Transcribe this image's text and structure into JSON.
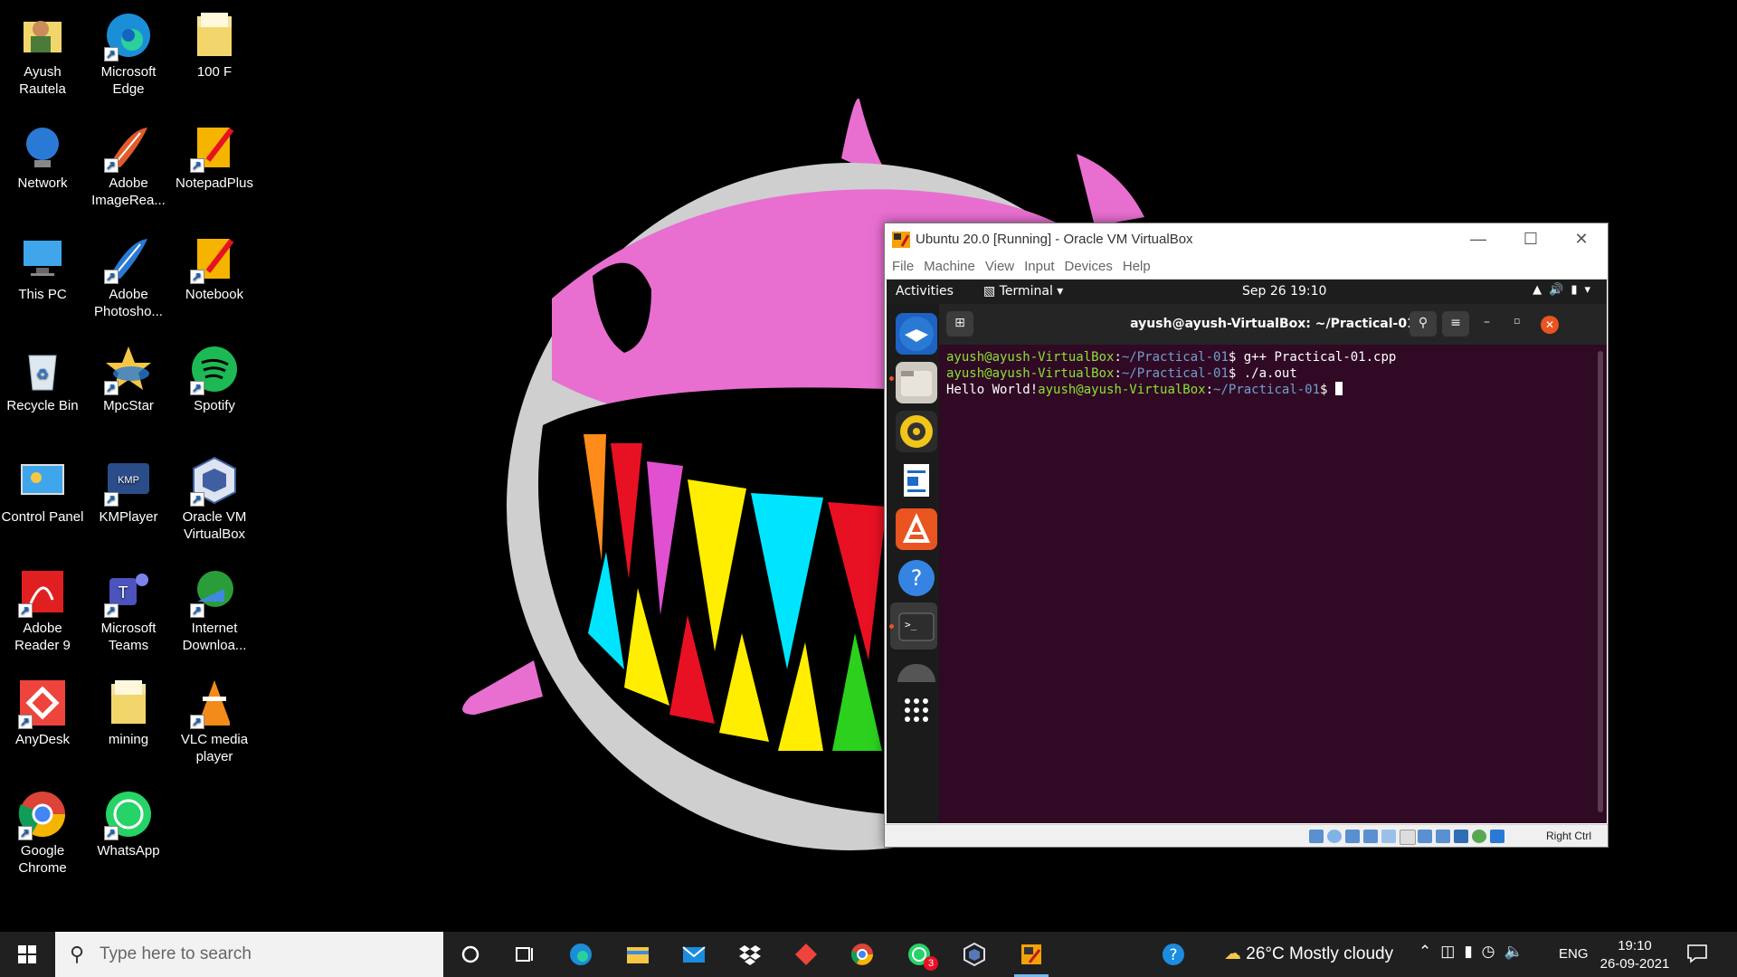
{
  "desktop": {
    "icons": [
      {
        "label": "Ayush Rautela",
        "icon": "user-folder-icon"
      },
      {
        "label": "Microsoft Edge",
        "icon": "edge-icon"
      },
      {
        "label": "100 F",
        "icon": "folder-icon"
      },
      {
        "label": "Network",
        "icon": "network-icon"
      },
      {
        "label": "Adobe ImageRea...",
        "icon": "adobe-imageready-icon"
      },
      {
        "label": "NotepadPlus",
        "icon": "notepad-icon"
      },
      {
        "label": "This PC",
        "icon": "computer-icon"
      },
      {
        "label": "Adobe Photosho...",
        "icon": "adobe-photoshop-icon"
      },
      {
        "label": "Notebook",
        "icon": "notebook-icon"
      },
      {
        "label": "Recycle Bin",
        "icon": "recycle-bin-icon"
      },
      {
        "label": "MpcStar",
        "icon": "mpcstar-icon"
      },
      {
        "label": "Spotify",
        "icon": "spotify-icon"
      },
      {
        "label": "Control Panel",
        "icon": "control-panel-icon"
      },
      {
        "label": "KMPlayer",
        "icon": "kmplayer-icon"
      },
      {
        "label": "Oracle VM VirtualBox",
        "icon": "virtualbox-icon"
      },
      {
        "label": "Adobe Reader 9",
        "icon": "adobe-reader-icon"
      },
      {
        "label": "Microsoft Teams",
        "icon": "teams-icon"
      },
      {
        "label": "Internet Downloa...",
        "icon": "idm-icon"
      },
      {
        "label": "AnyDesk",
        "icon": "anydesk-icon"
      },
      {
        "label": "mining",
        "icon": "folder-icon"
      },
      {
        "label": "VLC media player",
        "icon": "vlc-icon"
      },
      {
        "label": "Google Chrome",
        "icon": "chrome-icon"
      },
      {
        "label": "WhatsApp",
        "icon": "whatsapp-icon"
      }
    ]
  },
  "vbox": {
    "title": "Ubuntu 20.0 [Running] - Oracle VM VirtualBox",
    "menu": [
      "File",
      "Machine",
      "View",
      "Input",
      "Devices",
      "Help"
    ],
    "status_host_key": "Right Ctrl"
  },
  "ubuntu": {
    "activities": "Activities",
    "app_menu": "Terminal ▾",
    "clock": "Sep 26  19:10",
    "terminal_title": "ayush@ayush-VirtualBox: ~/Practical-01",
    "lines": [
      {
        "user": "ayush@ayush-VirtualBox",
        "path": "~/Practical-01",
        "cmd": "$ g++ Practical-01.cpp"
      },
      {
        "user": "ayush@ayush-VirtualBox",
        "path": "~/Practical-01",
        "cmd": "$ ./a.out"
      }
    ],
    "output": "Hello World!",
    "prompt_user": "ayush@ayush-VirtualBox",
    "prompt_path": "~/Practical-01",
    "prompt_end": "$ "
  },
  "taskbar": {
    "search_placeholder": "Type here to search",
    "whatsapp_badge": "3",
    "weather": "26°C  Mostly cloudy",
    "language": "ENG",
    "time": "19:10",
    "date": "26-09-2021"
  }
}
